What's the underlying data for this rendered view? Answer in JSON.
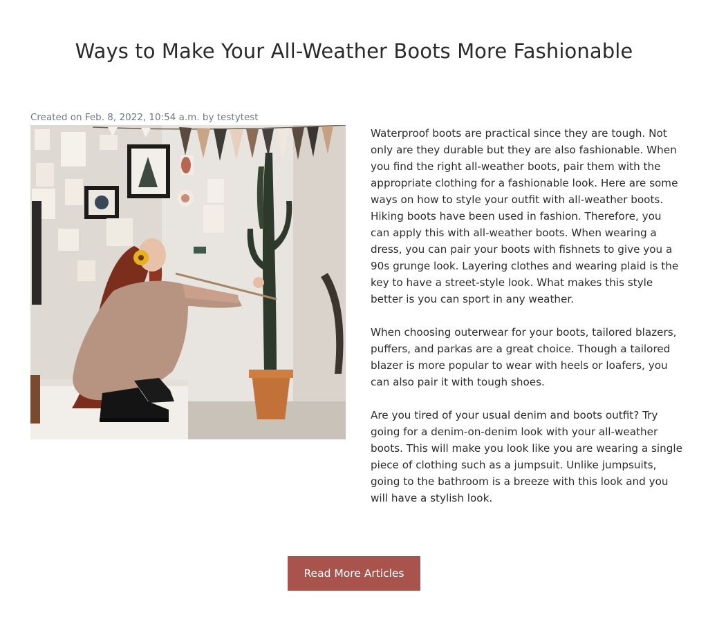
{
  "article": {
    "title": "Ways to Make Your All-Weather Boots More Fashionable",
    "meta": "Created on Feb. 8, 2022, 10:54 a.m. by testytest",
    "paragraphs": [
      "Waterproof boots are practical since they are tough. Not only are they durable but they are also fashionable. When you find the right all-weather boots, pair them with the appropriate clothing for a fashionable look. Here are some ways on how to style your outfit with all-weather boots. Hiking boots have been used in fashion. Therefore, you can apply this with all-weather boots. When wearing a dress, you can pair your boots with fishnets to give you a 90s grunge look. Layering clothes and wearing plaid is the key to have a street-style look. What makes this style better is you can sport in any weather.",
      "When choosing outerwear for your boots, tailored blazers, puffers, and parkas are a great choice. Though a tailored blazer is more popular to wear with heels or loafers, you can also pair it with tough shoes.",
      "Are you tired of your usual denim and boots outfit? Try going for a denim-on-denim look with your all-weather boots. This will make you look like you are wearing a single piece of clothing such as a jumpsuit. Unlike jumpsuits, going to the bathroom is a breeze with this look and you will have a stylish look."
    ]
  },
  "actions": {
    "read_more_label": "Read More Articles"
  },
  "colors": {
    "button_bg": "#a9534d",
    "meta_text": "#6e7780",
    "body_text": "#2b2b2b"
  }
}
